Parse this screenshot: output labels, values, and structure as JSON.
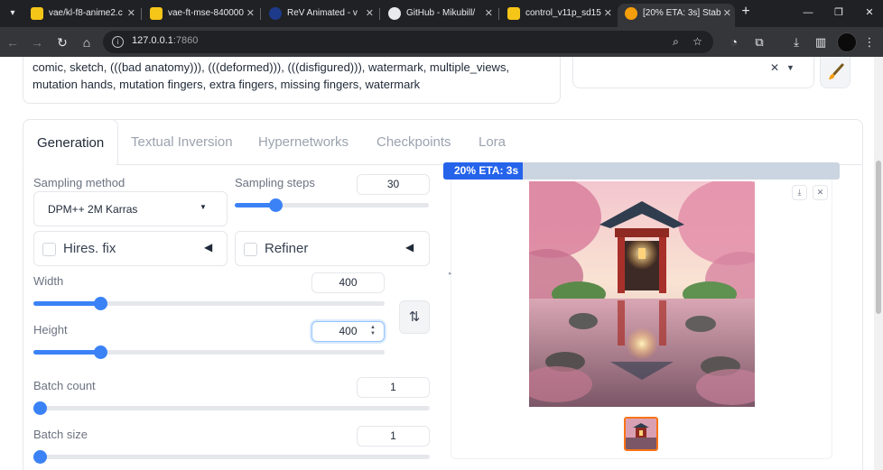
{
  "browser": {
    "tabs": [
      {
        "title": "vae/kl-f8-anime2.c",
        "icon": "huggingface-icon",
        "color": "#f5c518"
      },
      {
        "title": "vae-ft-mse-840000",
        "icon": "huggingface-icon",
        "color": "#f5c518"
      },
      {
        "title": "ReV Animated - v",
        "icon": "civitai-icon",
        "color": "#1e3a8a"
      },
      {
        "title": "GitHub - Mikubill/",
        "icon": "github-icon",
        "color": "#e8eaed"
      },
      {
        "title": "control_v11p_sd15",
        "icon": "huggingface-icon",
        "color": "#f5c518"
      },
      {
        "title": "[20% ETA: 3s] Stab",
        "icon": "stable-diffusion-icon",
        "color": "#f59e0b"
      }
    ],
    "url_host": "127.0.0.1",
    "url_port": ":7860"
  },
  "negative_prompt": {
    "text": "comic, sketch, (((bad anatomy))), (((deformed))), (((disfigured))), watermark, multiple_views, mutation hands, mutation fingers, extra fingers, missing fingers, watermark"
  },
  "tabs": [
    "Generation",
    "Textual Inversion",
    "Hypernetworks",
    "Checkpoints",
    "Lora"
  ],
  "generation": {
    "sampling_method_label": "Sampling method",
    "sampling_method_value": "DPM++ 2M Karras",
    "sampling_steps_label": "Sampling steps",
    "sampling_steps_value": "30",
    "sampling_steps_fraction": 0.19,
    "hires_fix_label": "Hires. fix",
    "refiner_label": "Refiner",
    "width_label": "Width",
    "width_value": "400",
    "width_fraction": 0.18,
    "height_label": "Height",
    "height_value": "400",
    "height_fraction": 0.18,
    "batch_count_label": "Batch count",
    "batch_count_value": "1",
    "batch_count_fraction": 0.0,
    "batch_size_label": "Batch size",
    "batch_size_value": "1",
    "batch_size_fraction": 0.0
  },
  "output": {
    "progress_text": "20% ETA: 3s",
    "progress_percent": 20
  },
  "colors": {
    "accent": "#3b82f6",
    "progress": "#2563eb",
    "thumb_border": "#f97316"
  }
}
